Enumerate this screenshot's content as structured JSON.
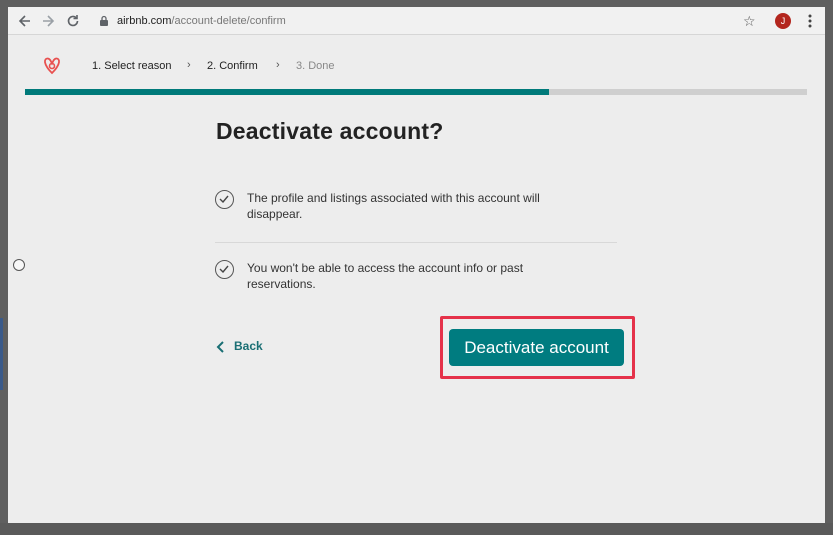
{
  "browser": {
    "url_host": "airbnb.com",
    "url_path": "/account-delete/confirm",
    "avatar_letter": "J",
    "icons": [
      "back-arrow-icon",
      "forward-arrow-icon",
      "reload-icon",
      "lock-icon",
      "star-icon",
      "kebab-menu-icon"
    ]
  },
  "steps": [
    {
      "label": "1. Select reason",
      "active": true
    },
    {
      "label": "2. Confirm",
      "active": true
    },
    {
      "label": "3. Done",
      "active": false
    }
  ],
  "progress": {
    "percent": 67,
    "fill_color": "#007a7a",
    "track_color": "#cfcfcf"
  },
  "title": "Deactivate account?",
  "consequences": [
    {
      "line1": "The profile and listings associated with this account will",
      "line2": "disappear."
    },
    {
      "line1": "You won't be able to access the account info or past",
      "line2": "reservations."
    }
  ],
  "back_label": "Back",
  "deactivate_label": "Deactivate account",
  "colors": {
    "accent": "#007c80",
    "highlight": "#e5324a",
    "logo": "#e8504f"
  }
}
